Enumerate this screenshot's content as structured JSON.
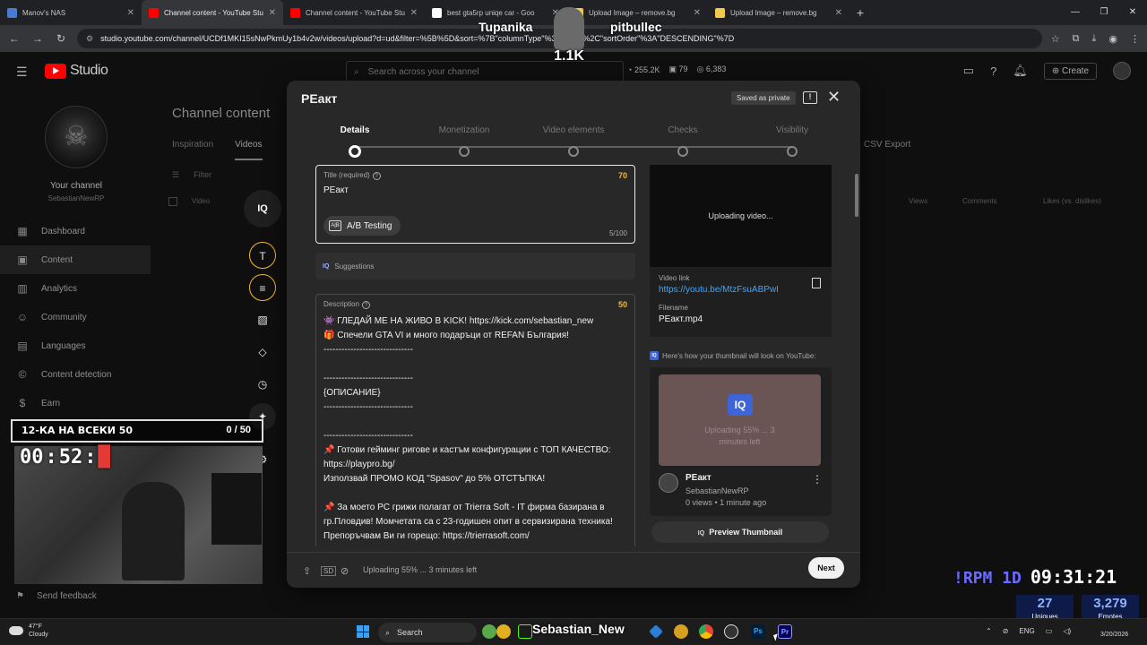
{
  "browser": {
    "tabs": [
      {
        "title": "Manov's NAS",
        "color": "#4a7bd0",
        "active": false
      },
      {
        "title": "Channel content - YouTube Stu",
        "color": "#ff0000",
        "active": true
      },
      {
        "title": "Channel content - YouTube Stu",
        "color": "#ff0000",
        "active": false
      },
      {
        "title": "best gta5rp uniqe car - Goo",
        "color": "#ffffff",
        "active": false
      },
      {
        "title": "Upload Image – remove.bg",
        "color": "#f2c94c",
        "active": false
      },
      {
        "title": "Upload Image – remove.bg",
        "color": "#f2c94c",
        "active": false
      }
    ],
    "url": "studio.youtube.com/channel/UCDf1MKI15sNwPkmUy1b4v2w/videos/upload?d=ud&filter=%5B%5D&sort=%7B\"columnType\"%3A\"date\"%2C\"sortOrder\"%3A\"DESCENDING\"%7D"
  },
  "studio": {
    "logo_text": "Studio",
    "search_placeholder": "Search across your channel",
    "stats": [
      "255.2K",
      "79",
      "6,383"
    ],
    "create_label": "Create",
    "channel_label": "Your channel",
    "channel_handle": "SebastianNewRP",
    "nav": [
      {
        "label": "Dashboard",
        "icon": "dashboard-icon",
        "glyph": "▦"
      },
      {
        "label": "Content",
        "icon": "content-icon",
        "glyph": "▣",
        "active": true
      },
      {
        "label": "Analytics",
        "icon": "analytics-icon",
        "glyph": "▥"
      },
      {
        "label": "Community",
        "icon": "community-icon",
        "glyph": "☺"
      },
      {
        "label": "Languages",
        "icon": "languages-icon",
        "glyph": "▤"
      },
      {
        "label": "Content detection",
        "icon": "copyright-icon",
        "glyph": "©"
      },
      {
        "label": "Earn",
        "icon": "earn-icon",
        "glyph": "$"
      }
    ],
    "feedback": "Send feedback",
    "page_title": "Channel content",
    "page_tabs": [
      "Inspiration",
      "Videos"
    ],
    "csv": "CSV Export",
    "filter_label": "Filter",
    "table_headers": [
      "Video",
      "Views",
      "Comments",
      "Likes (vs. dislikes)"
    ]
  },
  "modal": {
    "title": "РЕакт",
    "saved": "Saved as private",
    "steps": [
      "Details",
      "Monetization",
      "Video elements",
      "Checks",
      "Visibility"
    ],
    "title_field": {
      "label": "Title (required)",
      "score": "70",
      "value": "РЕакт",
      "ab_label": "A/B Testing",
      "count": "5/100"
    },
    "suggestions": "Suggestions",
    "description": {
      "label": "Description",
      "score": "50",
      "lines": [
        "👾 ГЛЕДАЙ МЕ НА ЖИВО В KICK! https://kick.com/sebastian_new",
        "🎁 Спечели GTA VI и много подаръци от REFAN България!",
        "------------------------------",
        "",
        "------------------------------",
        "{ОПИСАНИЕ}",
        "------------------------------",
        "",
        "------------------------------",
        "📌 Готови гейминг ригове и кастъм конфигурации с ТОП КАЧЕСТВО:",
        "https://playpro.bg/",
        "Използвай ПРОМО КОД \"Spasov\" до 5% ОТСТЪПКА!",
        "",
        "📌 За моето PC грижи полагат от Trierra Soft  -  IT фирма базирана в",
        "гр.Пловдив! Момчетата са с 23-годишен опит в сервизирана техника!",
        "Препоръчвам Ви ги горещо:  https://trierrasoft.com/"
      ]
    },
    "preview_status": "Uploading video...",
    "video_link_label": "Video link",
    "video_link": "https://youtu.be/MtzFsuABPwI",
    "filename_label": "Filename",
    "filename": "РЕакт.mp4",
    "thumb_note": "Here's how your thumbnail will look on YouTube:",
    "thumb_uploading": "Uploading 55% ... 3 minutes left",
    "card_title": "РЕакт",
    "card_channel": "SebastianNewRP",
    "card_meta": "0 views • 1 minute ago",
    "preview_thumbnail": "Preview Thumbnail",
    "footer_status": "Uploading 55% ... 3 minutes left",
    "next": "Next"
  },
  "toolbar_label": "IQ",
  "overlay": {
    "counter_label": "12-КА НА ВСЕКИ 50",
    "counter_value": "0 / 50",
    "timer_mm": "00",
    "timer_ss": "52",
    "top_name_1": "Tupanika",
    "top_name_2": "pitbullec",
    "top_value": "1.1K",
    "rpm_label": "!RPM 1D",
    "clock": "09:31:21",
    "uniques_value": "27",
    "uniques_label": "Uniques",
    "emotes_value": "3,279",
    "emotes_label": "Emotes"
  },
  "taskbar": {
    "temp": "47°F",
    "weather": "Cloudy",
    "search": "Search",
    "live_name": "Sebastian_New",
    "lang": "ENG",
    "date": "3/20/2026"
  }
}
